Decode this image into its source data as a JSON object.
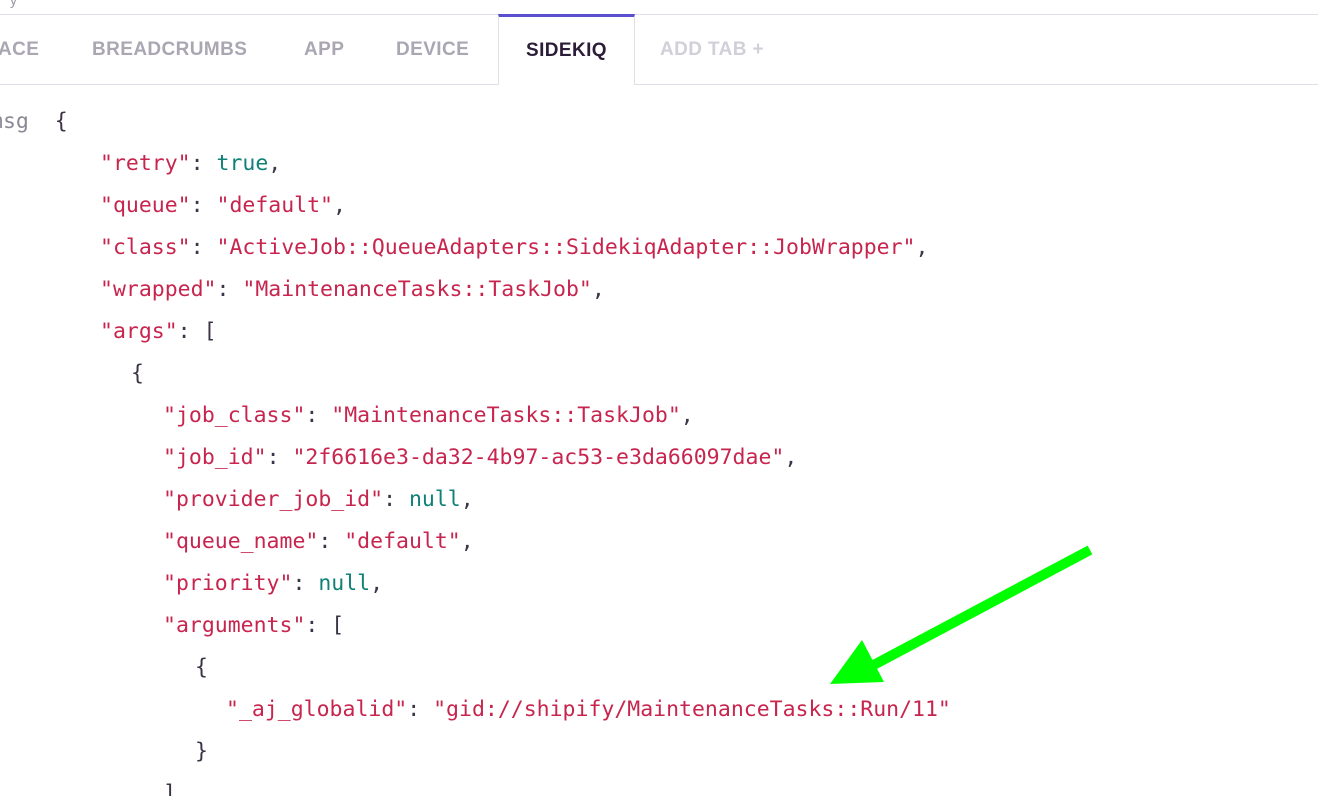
{
  "tabs": [
    {
      "label": "ACE"
    },
    {
      "label": "BREADCRUMBS"
    },
    {
      "label": "APP"
    },
    {
      "label": "DEVICE"
    },
    {
      "label": "SIDEKIQ"
    },
    {
      "label": "ADD TAB +"
    }
  ],
  "active_tab": "SIDEKIQ",
  "accent_color": "#5a4fcf",
  "annotation_color": "#00ff00",
  "context": {
    "key_label": "msg",
    "lines": {
      "open_brace": "{",
      "retry_key": "\"retry\"",
      "retry_value": "true",
      "queue_key": "\"queue\"",
      "queue_value": "\"default\"",
      "class_key": "\"class\"",
      "class_value": "\"ActiveJob::QueueAdapters::SidekiqAdapter::JobWrapper\"",
      "wrapped_key": "\"wrapped\"",
      "wrapped_value": "\"MaintenanceTasks::TaskJob\"",
      "args_key": "\"args\"",
      "args_open": "[",
      "obj_open": "{",
      "job_class_key": "\"job_class\"",
      "job_class_value": "\"MaintenanceTasks::TaskJob\"",
      "job_id_key": "\"job_id\"",
      "job_id_value": "\"2f6616e3-da32-4b97-ac53-e3da66097dae\"",
      "provider_job_id_key": "\"provider_job_id\"",
      "provider_job_id_value": "null",
      "queue_name_key": "\"queue_name\"",
      "queue_name_value": "\"default\"",
      "priority_key": "\"priority\"",
      "priority_value": "null",
      "arguments_key": "\"arguments\"",
      "arguments_open": "[",
      "inner_obj_open": "{",
      "globalid_key": "\"_aj_globalid\"",
      "globalid_value": "\"gid://shipify/MaintenanceTasks::Run/11\"",
      "inner_obj_close": "}",
      "arguments_close": "]"
    }
  }
}
